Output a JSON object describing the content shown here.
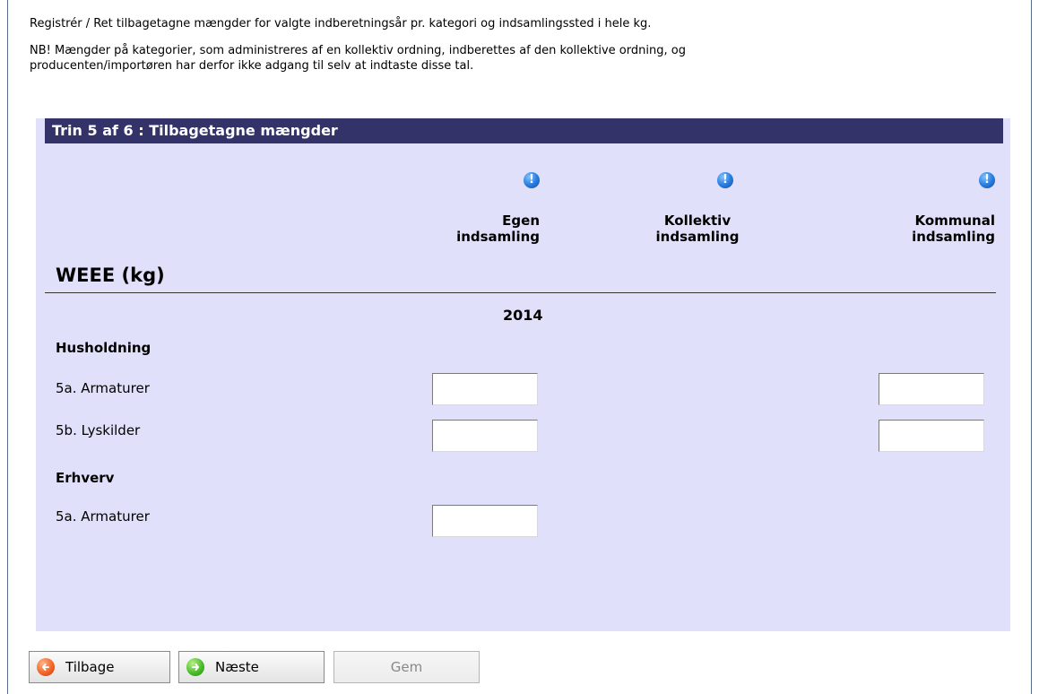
{
  "intro": {
    "line1": "Registrér / Ret tilbagetagne mængder for valgte indberetningsår pr. kategori og indsamlingssted i hele kg.",
    "line2": "NB! Mængder på kategorier, som administreres af en kollektiv ordning, indberettes af den kollektive ordning, og",
    "line3": "producenten/importøren har derfor ikke adgang til selv at indtaste disse tal."
  },
  "panel": {
    "title": "Trin 5 af 6 : Tilbagetagne mængder",
    "section_title": "WEEE (kg)",
    "year": "2014",
    "info_icon_glyph": "!",
    "columns": [
      {
        "line1": "Egen",
        "line2": "indsamling",
        "icon": "info-icon"
      },
      {
        "line1": "Kollektiv",
        "line2": "indsamling",
        "icon": "info-icon"
      },
      {
        "line1": "Kommunal",
        "line2": "indsamling",
        "icon": "info-icon"
      }
    ],
    "groups": [
      {
        "label": "Husholdning",
        "rows": [
          {
            "label": "5a. Armaturer",
            "egen": "",
            "kommunal": ""
          },
          {
            "label": "5b. Lyskilder",
            "egen": "",
            "kommunal": ""
          }
        ]
      },
      {
        "label": "Erhverv",
        "rows": [
          {
            "label": "5a. Armaturer",
            "egen": ""
          }
        ]
      }
    ]
  },
  "buttons": {
    "back": {
      "label": "Tilbage",
      "icon": "arrow-left-icon"
    },
    "next": {
      "label": "Næste",
      "icon": "arrow-right-icon"
    },
    "save": {
      "label": "Gem"
    }
  },
  "colors": {
    "panel_background": "#e0e0fa",
    "title_bar": "#33336a",
    "info_icon": "#2d7fe0",
    "back_icon": "#f2662a",
    "next_icon": "#4cbd2a"
  }
}
